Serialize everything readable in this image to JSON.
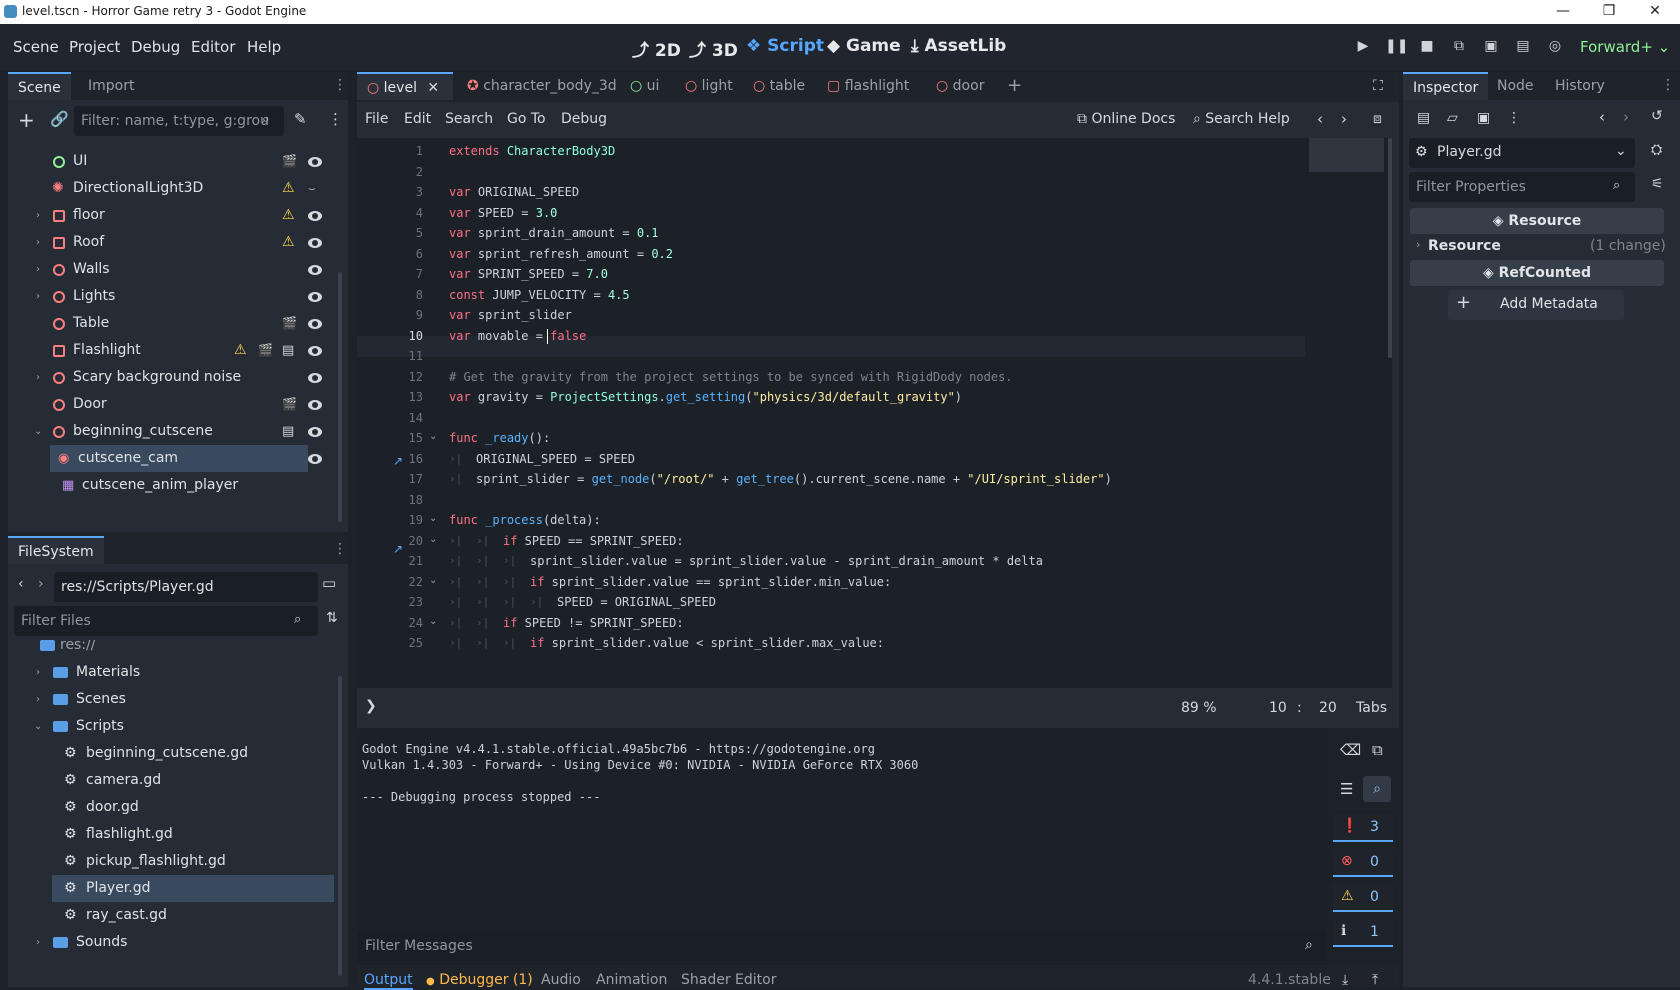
{
  "window": {
    "title": "level.tscn - Horror Game retry 3 - Godot Engine"
  },
  "menu": {
    "items": [
      "Scene",
      "Project",
      "Debug",
      "Editor",
      "Help"
    ],
    "modes": [
      "2D",
      "3D",
      "Script",
      "Game",
      "AssetLib"
    ],
    "active_mode": "Script",
    "renderer": "Forward+"
  },
  "scene_dock": {
    "tabs": [
      "Scene",
      "Import"
    ],
    "filter_placeholder": "Filter: name, t:type, g:grou",
    "nodes": [
      {
        "label": "UI",
        "icon": "control-node-icon"
      },
      {
        "label": "DirectionalLight3D",
        "icon": "light-icon"
      },
      {
        "label": "floor",
        "icon": "mesh-icon"
      },
      {
        "label": "Roof",
        "icon": "mesh-icon"
      },
      {
        "label": "Walls",
        "icon": "node3d-icon"
      },
      {
        "label": "Lights",
        "icon": "node3d-icon"
      },
      {
        "label": "Table",
        "icon": "node3d-icon"
      },
      {
        "label": "Flashlight",
        "icon": "mesh-icon"
      },
      {
        "label": "Scary background noise",
        "icon": "node3d-icon"
      },
      {
        "label": "Door",
        "icon": "node3d-icon"
      },
      {
        "label": "beginning_cutscene",
        "icon": "node3d-icon"
      },
      {
        "label": "cutscene_cam",
        "icon": "camera-icon"
      },
      {
        "label": "cutscene_anim_player",
        "icon": "animation-player-icon"
      }
    ]
  },
  "filesystem": {
    "tab": "FileSystem",
    "path": "res://Scripts/Player.gd",
    "filter_placeholder": "Filter Files",
    "root": "res://",
    "items": [
      {
        "label": "Materials",
        "type": "folder"
      },
      {
        "label": "Scenes",
        "type": "folder"
      },
      {
        "label": "Scripts",
        "type": "folder"
      },
      {
        "label": "beginning_cutscene.gd",
        "type": "script"
      },
      {
        "label": "camera.gd",
        "type": "script"
      },
      {
        "label": "door.gd",
        "type": "script"
      },
      {
        "label": "flashlight.gd",
        "type": "script"
      },
      {
        "label": "pickup_flashlight.gd",
        "type": "script"
      },
      {
        "label": "Player.gd",
        "type": "script"
      },
      {
        "label": "ray_cast.gd",
        "type": "script"
      },
      {
        "label": "Sounds",
        "type": "folder"
      }
    ]
  },
  "editor_tabs": [
    {
      "label": "level",
      "active": true
    },
    {
      "label": "character_body_3d"
    },
    {
      "label": "ui"
    },
    {
      "label": "light"
    },
    {
      "label": "table"
    },
    {
      "label": "flashlight"
    },
    {
      "label": "door"
    }
  ],
  "script_menu": {
    "items": [
      "File",
      "Edit",
      "Search",
      "Go To",
      "Debug"
    ],
    "online_docs": "Online Docs",
    "search_help": "Search Help"
  },
  "code": {
    "line_numbers": [
      "1",
      "2",
      "3",
      "4",
      "5",
      "6",
      "7",
      "8",
      "9",
      "10",
      "11",
      "12",
      "13",
      "14",
      "15",
      "16",
      "17",
      "18",
      "19",
      "20",
      "21",
      "22",
      "23",
      "24",
      "25"
    ],
    "lines": [
      "extends CharacterBody3D",
      "",
      "var ORIGINAL_SPEED",
      "var SPEED = 3.0",
      "var sprint_drain_amount = 0.1",
      "var sprint_refresh_amount = 0.2",
      "var SPRINT_SPEED = 7.0",
      "const JUMP_VELOCITY = 4.5",
      "var sprint_slider",
      "var movable = false",
      "",
      "# Get the gravity from the project settings to be synced with RigidDody nodes.",
      "var gravity = ProjectSettings.get_setting(\"physics/3d/default_gravity\")",
      "",
      "func _ready():",
      "ORIGINAL_SPEED = SPEED",
      "sprint_slider = get_node(\"/root/\" + get_tree().current_scene.name + \"/UI/sprint_slider\")",
      "",
      "func _process(delta):",
      "if SPEED == SPRINT_SPEED:",
      "sprint_slider.value = sprint_slider.value - sprint_drain_amount * delta",
      "if sprint_slider.value == sprint_slider.min_value:",
      "SPEED = ORIGINAL_SPEED",
      "if SPEED != SPRINT_SPEED:",
      "if sprint_slider.value < sprint_slider.max_value:"
    ]
  },
  "status": {
    "zoom": "89 %",
    "line": "10",
    "col": "20",
    "indent": "Tabs"
  },
  "output": {
    "lines": [
      "Godot Engine v4.4.1.stable.official.49a5bc7b6 - https://godotengine.org",
      "Vulkan 1.4.303 - Forward+ - Using Device #0: NVIDIA - NVIDIA GeForce RTX 3060",
      "",
      "--- Debugging process stopped ---"
    ],
    "filter_placeholder": "Filter Messages",
    "counts": {
      "messages": "3",
      "errors": "0",
      "warnings": "0",
      "info": "1"
    }
  },
  "bottom_tabs": [
    "Output",
    "Debugger (1)",
    "Audio",
    "Animation",
    "Shader Editor"
  ],
  "version": "4.4.1.stable",
  "inspector": {
    "tabs": [
      "Inspector",
      "Node",
      "History"
    ],
    "object": "Player.gd",
    "filter_placeholder": "Filter Properties",
    "section_resource": "Resource",
    "resource_label": "Resource",
    "resource_change": "(1 change)",
    "section_refcounted": "RefCounted",
    "add_metadata": "Add Metadata"
  }
}
